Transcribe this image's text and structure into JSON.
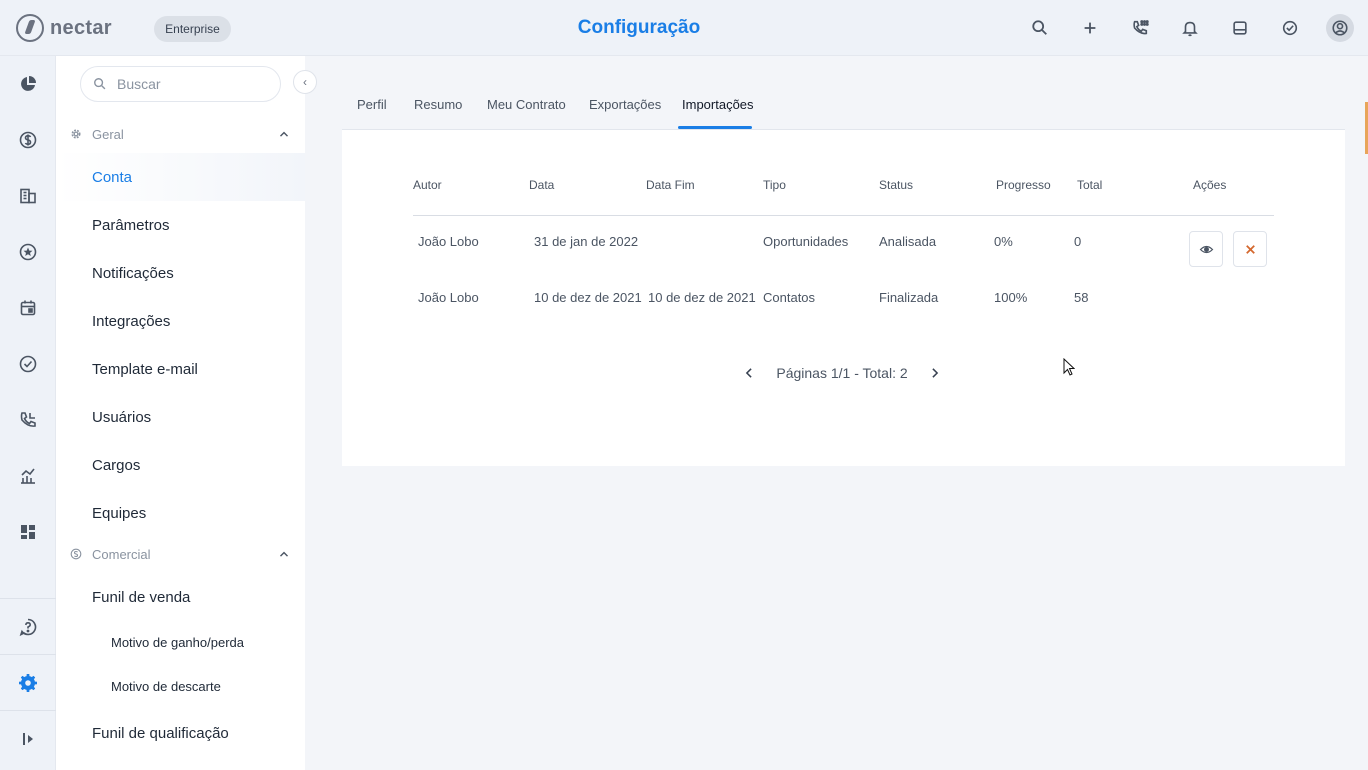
{
  "header": {
    "logo_text": "nectar",
    "plan_badge": "Enterprise",
    "title": "Configuração",
    "icons": [
      "search-icon",
      "plus-icon",
      "phone-dialpad-icon",
      "bell-icon",
      "inbox-icon",
      "check-circle-icon",
      "user-avatar-icon"
    ]
  },
  "rail": {
    "items": [
      "pie-chart-icon",
      "dollar-icon",
      "building-icon",
      "star-icon",
      "calendar-icon",
      "check-circle-icon",
      "phone-icon",
      "analytics-icon",
      "dashboard-icon"
    ],
    "bottom": [
      "help-icon",
      "settings-icon",
      "expand-icon"
    ]
  },
  "sidebar": {
    "search_placeholder": "Buscar",
    "sections": [
      {
        "title": "Geral",
        "items": [
          "Conta",
          "Parâmetros",
          "Notificações",
          "Integrações",
          "Template e-mail",
          "Usuários",
          "Cargos",
          "Equipes"
        ]
      },
      {
        "title": "Comercial",
        "items": [
          "Funil de venda",
          "Motivo de ganho/perda",
          "Motivo de descarte",
          "Funil de qualificação"
        ]
      }
    ],
    "active_item": "Conta"
  },
  "tabs": [
    "Perfil",
    "Resumo",
    "Meu Contrato",
    "Exportações",
    "Importações"
  ],
  "active_tab": "Importações",
  "table": {
    "headers": [
      "Autor",
      "Data",
      "Data Fim",
      "Tipo",
      "Status",
      "Progresso",
      "Total",
      "Ações"
    ],
    "rows": [
      [
        "João Lobo",
        "31 de jan de 2022",
        "",
        "Oportunidades",
        "Analisada",
        "0%",
        "0"
      ],
      [
        "João Lobo",
        "10 de dez de 2021",
        "10 de dez de 2021",
        "Contatos",
        "Finalizada",
        "100%",
        "58"
      ]
    ]
  },
  "pagination": {
    "text": "Páginas 1/1 - Total: 2"
  },
  "colors": {
    "accent": "#1a7ee6",
    "delete": "#d4682e",
    "rail_bg": "#eef2f8",
    "page_bg": "#f3f5f9"
  }
}
